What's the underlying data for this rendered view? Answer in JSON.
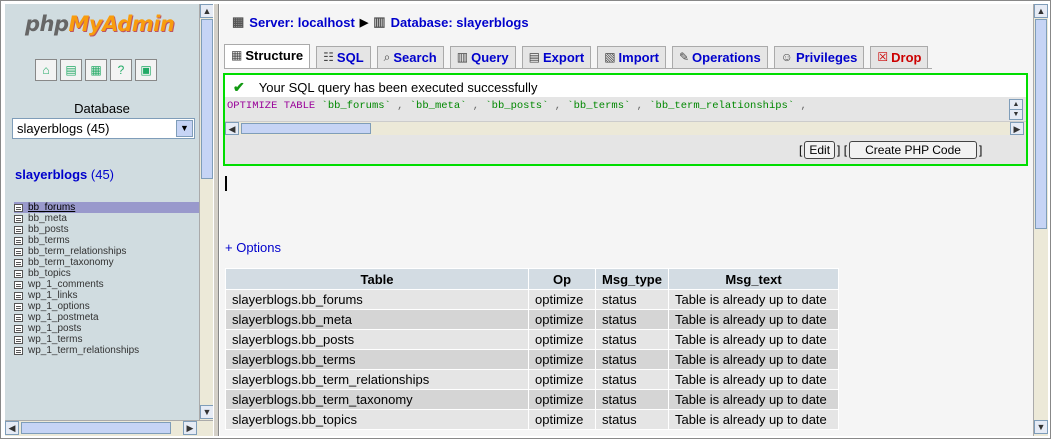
{
  "nav": {
    "logo_php": "php",
    "logo_myadmin": "MyAdmin",
    "icons": [
      "home-icon",
      "query-window-icon",
      "sql-icon",
      "docs-icon",
      "sql-doc-icon"
    ],
    "database_label": "Database",
    "database_select_value": "slayerblogs (45)",
    "db_title": "slayerblogs",
    "db_count": "(45)",
    "tables": [
      "bb_forums",
      "bb_meta",
      "bb_posts",
      "bb_terms",
      "bb_term_relationships",
      "bb_term_taxonomy",
      "bb_topics",
      "wp_1_comments",
      "wp_1_links",
      "wp_1_options",
      "wp_1_postmeta",
      "wp_1_posts",
      "wp_1_terms",
      "wp_1_term_relationships"
    ],
    "active_table_index": 0
  },
  "breadcrumb": {
    "server": "Server: localhost",
    "database": "Database: slayerblogs"
  },
  "tabs": [
    {
      "label": "Structure",
      "icon": "structure-icon",
      "active": true
    },
    {
      "label": "SQL",
      "icon": "sql-icon",
      "active": false
    },
    {
      "label": "Search",
      "icon": "search-icon",
      "active": false
    },
    {
      "label": "Query",
      "icon": "query-icon",
      "active": false
    },
    {
      "label": "Export",
      "icon": "export-icon",
      "active": false
    },
    {
      "label": "Import",
      "icon": "import-icon",
      "active": false
    },
    {
      "label": "Operations",
      "icon": "operations-icon",
      "active": false
    },
    {
      "label": "Privileges",
      "icon": "privileges-icon",
      "active": false
    },
    {
      "label": "Drop",
      "icon": "drop-icon",
      "active": false
    }
  ],
  "message": {
    "success_text": "Your SQL query has been executed successfully",
    "sql_keyword": "OPTIMIZE TABLE",
    "sql_tables": [
      "`bb_forums`",
      "`bb_meta`",
      "`bb_posts`",
      "`bb_terms`",
      "`bb_term_relationships`"
    ],
    "edit_label": "Edit",
    "create_php_label": "Create PHP Code"
  },
  "options_link": "+ Options",
  "results": {
    "headers": [
      "Table",
      "Op",
      "Msg_type",
      "Msg_text"
    ],
    "rows": [
      [
        "slayerblogs.bb_forums",
        "optimize",
        "status",
        "Table is already up to date"
      ],
      [
        "slayerblogs.bb_meta",
        "optimize",
        "status",
        "Table is already up to date"
      ],
      [
        "slayerblogs.bb_posts",
        "optimize",
        "status",
        "Table is already up to date"
      ],
      [
        "slayerblogs.bb_terms",
        "optimize",
        "status",
        "Table is already up to date"
      ],
      [
        "slayerblogs.bb_term_relationships",
        "optimize",
        "status",
        "Table is already up to date"
      ],
      [
        "slayerblogs.bb_term_taxonomy",
        "optimize",
        "status",
        "Table is already up to date"
      ],
      [
        "slayerblogs.bb_topics",
        "optimize",
        "status",
        "Table is already up to date"
      ]
    ]
  },
  "colors": {
    "link": "#0000cc",
    "success_border": "#00dd00",
    "nav_bg": "#d0dce0",
    "header_bg": "#d3dce3",
    "active_row": "#9999cc",
    "drop": "#cc0000"
  }
}
